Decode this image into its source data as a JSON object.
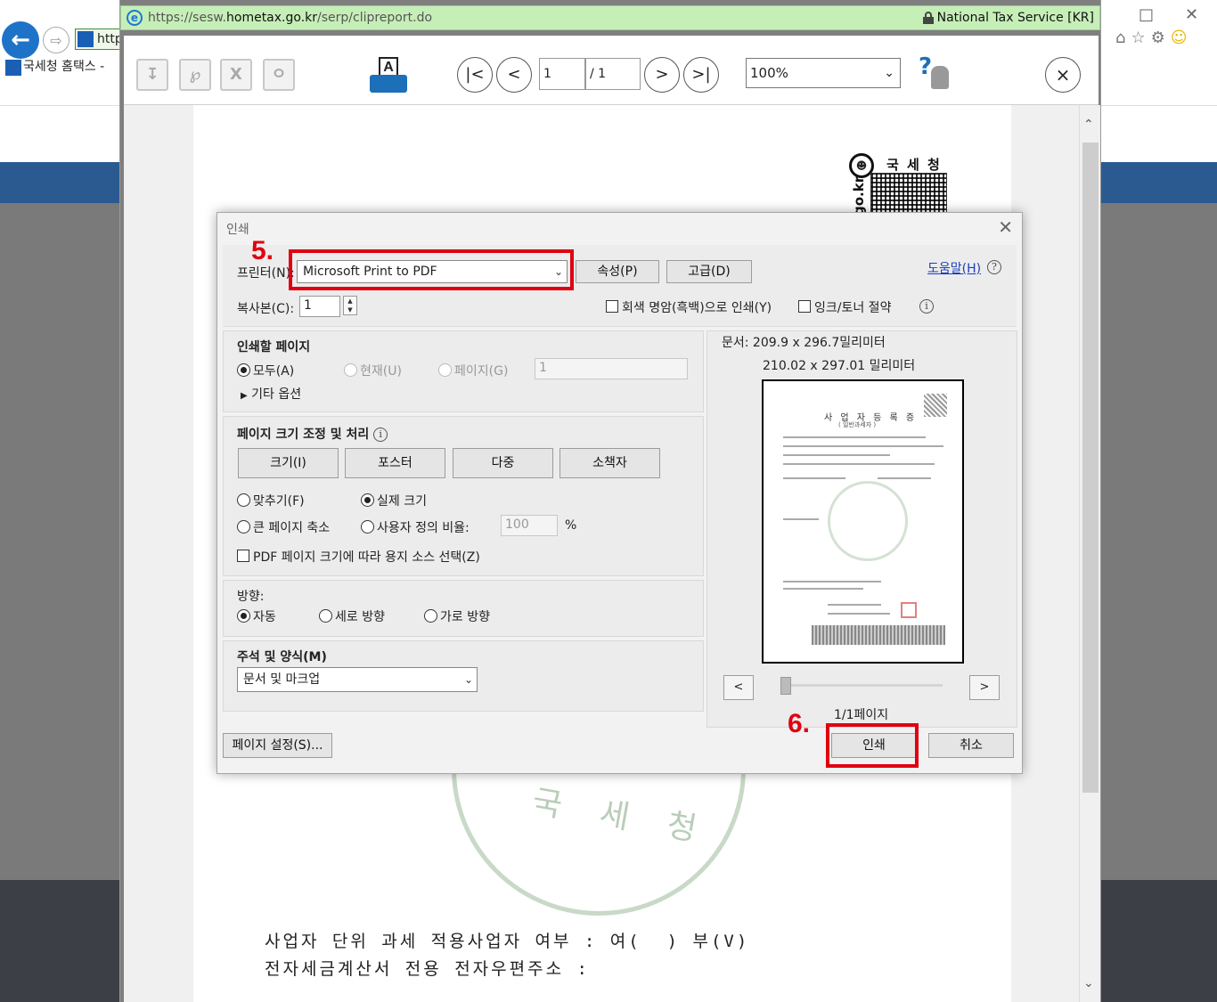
{
  "background": {
    "address_short": "http",
    "tab_title": "국세청 홈택스 - "
  },
  "popup": {
    "url": {
      "prefix": "https://sesw.",
      "domain": "hometax.go.kr",
      "path": "/serp/clipreport.do"
    },
    "security_owner": "National Tax Service [KR]",
    "toolbar": {
      "print_icon_letter": "A",
      "first_page": "|<",
      "prev_page": "<",
      "current_page": "1",
      "total_pages": "/ 1",
      "next_page": ">",
      "last_page": ">|",
      "zoom": "100%",
      "help_icon": "?",
      "close": "×"
    }
  },
  "document": {
    "logo_name": "국 세 청",
    "logo_domain": "go.kr",
    "watermark_text": "국 세 청",
    "line1": "사업자 단위 과세 적용사업자 여부 : 여(  ) 부(V)",
    "line2": "전자세금계산서 전용 전자우편주소 :"
  },
  "dialog": {
    "title": "인쇄",
    "printer_label": "프린터(N):",
    "printer_value": "Microsoft Print to PDF",
    "properties_button": "속성(P)",
    "advanced_button": "고급(D)",
    "help_link": "도움말(H)",
    "copies_label": "복사본(C):",
    "copies_value": "1",
    "grayscale_label": "회색 명암(흑백)으로 인쇄(Y)",
    "ink_saver_label": "잉크/토너 절약",
    "pages_section": {
      "title": "인쇄할 페이지",
      "all": "모두(A)",
      "current": "현재(U)",
      "pages": "페이지(G)",
      "pages_value": "1",
      "more_options": "기타 옵션"
    },
    "sizing_section": {
      "title": "페이지 크기 조정 및 처리",
      "tabs": [
        "크기(I)",
        "포스터",
        "다중",
        "소책자"
      ],
      "fit": "맞추기(F)",
      "actual_size": "실제 크기",
      "shrink": "큰 페이지 축소",
      "custom_scale": "사용자 정의 비율:",
      "custom_scale_value": "100",
      "percent": "%",
      "paper_source": "PDF 페이지 크기에 따라 용지 소스 선택(Z)"
    },
    "orientation_section": {
      "title": "방향:",
      "auto": "자동",
      "portrait": "세로 방향",
      "landscape": "가로 방향"
    },
    "comments_section": {
      "title": "주석 및 양식(M)",
      "value": "문서 및 마크업"
    },
    "preview": {
      "doc_size": "문서: 209.9 x 296.7밀리미터",
      "paper_size": "210.02 x 297.01 밀리미터",
      "page_title": "사 업 자 등 록 증",
      "page_subtitle": "( 일반과세자 )",
      "prev": "<",
      "next": ">",
      "page_indicator": "1/1페이지"
    },
    "page_setup_button": "페이지 설정(S)...",
    "print_button": "인쇄",
    "cancel_button": "취소"
  },
  "annotations": {
    "step5": "5.",
    "step6": "6.",
    "color": "#e00010"
  }
}
